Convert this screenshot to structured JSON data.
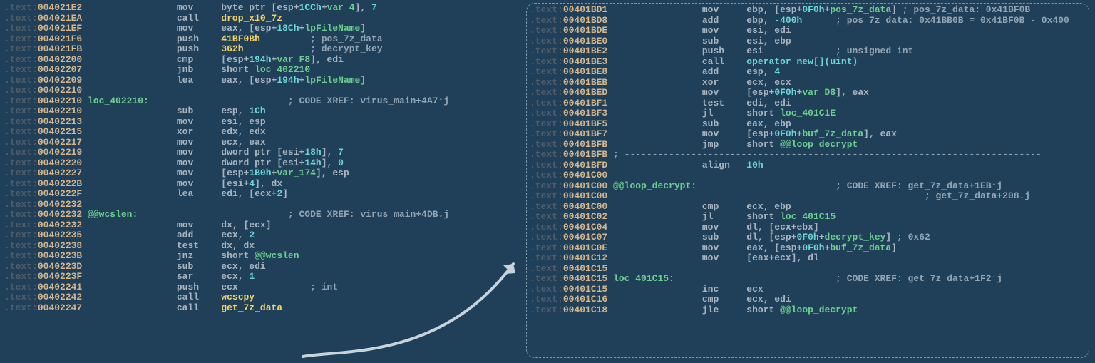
{
  "left": [
    {
      "addr": "004021E2",
      "m": "mov",
      "ops": [
        {
          "t": "plain",
          "v": "byte ptr "
        },
        {
          "t": "plain",
          "v": "["
        },
        {
          "t": "plain",
          "v": "esp"
        },
        {
          "t": "plain",
          "v": "+"
        },
        {
          "t": "num",
          "v": "1CCh"
        },
        {
          "t": "plain",
          "v": "+"
        },
        {
          "t": "var",
          "v": "var_4"
        },
        {
          "t": "plain",
          "v": "], "
        },
        {
          "t": "num",
          "v": "7"
        }
      ]
    },
    {
      "addr": "004021EA",
      "m": "call",
      "ops": [
        {
          "t": "func",
          "v": "drop_x10_7z"
        }
      ]
    },
    {
      "addr": "004021EF",
      "m": "mov",
      "ops": [
        {
          "t": "plain",
          "v": "eax, [esp+"
        },
        {
          "t": "num",
          "v": "18Ch"
        },
        {
          "t": "plain",
          "v": "+"
        },
        {
          "t": "var",
          "v": "lpFileName"
        },
        {
          "t": "plain",
          "v": "]"
        }
      ]
    },
    {
      "addr": "004021F6",
      "m": "push",
      "ops": [
        {
          "t": "func",
          "v": "41BF0Bh"
        },
        {
          "t": "plain",
          "v": "         "
        },
        {
          "t": "comment",
          "v": "; pos_7z_data"
        }
      ]
    },
    {
      "addr": "004021FB",
      "m": "push",
      "ops": [
        {
          "t": "func",
          "v": "362h"
        },
        {
          "t": "plain",
          "v": "            "
        },
        {
          "t": "comment",
          "v": "; decrypt_key"
        }
      ]
    },
    {
      "addr": "00402200",
      "m": "cmp",
      "ops": [
        {
          "t": "plain",
          "v": "[esp+"
        },
        {
          "t": "num",
          "v": "194h"
        },
        {
          "t": "plain",
          "v": "+"
        },
        {
          "t": "var",
          "v": "var_F8"
        },
        {
          "t": "plain",
          "v": "], edi"
        }
      ]
    },
    {
      "addr": "00402207",
      "m": "jnb",
      "ops": [
        {
          "t": "plain",
          "v": "short "
        },
        {
          "t": "var",
          "v": "loc_402210"
        }
      ]
    },
    {
      "addr": "00402209",
      "m": "lea",
      "ops": [
        {
          "t": "plain",
          "v": "eax, [esp+"
        },
        {
          "t": "num",
          "v": "194h"
        },
        {
          "t": "plain",
          "v": "+"
        },
        {
          "t": "var",
          "v": "lpFileName"
        },
        {
          "t": "plain",
          "v": "]"
        }
      ]
    },
    {
      "addr": "00402210",
      "m": "",
      "ops": []
    },
    {
      "addr": "00402210",
      "label": "loc_402210:",
      "m": "",
      "ops": [
        {
          "t": "plain",
          "v": "                         "
        },
        {
          "t": "comment",
          "v": "; CODE XREF: virus_main+4A7↑j"
        }
      ]
    },
    {
      "addr": "00402210",
      "m": "sub",
      "ops": [
        {
          "t": "plain",
          "v": "esp, "
        },
        {
          "t": "num",
          "v": "1Ch"
        }
      ]
    },
    {
      "addr": "00402213",
      "m": "mov",
      "ops": [
        {
          "t": "plain",
          "v": "esi, esp"
        }
      ]
    },
    {
      "addr": "00402215",
      "m": "xor",
      "ops": [
        {
          "t": "plain",
          "v": "edx, edx"
        }
      ]
    },
    {
      "addr": "00402217",
      "m": "mov",
      "ops": [
        {
          "t": "plain",
          "v": "ecx, eax"
        }
      ]
    },
    {
      "addr": "00402219",
      "m": "mov",
      "ops": [
        {
          "t": "plain",
          "v": "dword ptr [esi+"
        },
        {
          "t": "num",
          "v": "18h"
        },
        {
          "t": "plain",
          "v": "], "
        },
        {
          "t": "num",
          "v": "7"
        }
      ]
    },
    {
      "addr": "00402220",
      "m": "mov",
      "ops": [
        {
          "t": "plain",
          "v": "dword ptr [esi+"
        },
        {
          "t": "num",
          "v": "14h"
        },
        {
          "t": "plain",
          "v": "], "
        },
        {
          "t": "num",
          "v": "0"
        }
      ]
    },
    {
      "addr": "00402227",
      "m": "mov",
      "ops": [
        {
          "t": "plain",
          "v": "[esp+"
        },
        {
          "t": "num",
          "v": "1B0h"
        },
        {
          "t": "plain",
          "v": "+"
        },
        {
          "t": "var",
          "v": "var_174"
        },
        {
          "t": "plain",
          "v": "], esp"
        }
      ]
    },
    {
      "addr": "0040222B",
      "m": "mov",
      "ops": [
        {
          "t": "plain",
          "v": "[esi+"
        },
        {
          "t": "num",
          "v": "4"
        },
        {
          "t": "plain",
          "v": "], dx"
        }
      ]
    },
    {
      "addr": "0040222F",
      "m": "lea",
      "ops": [
        {
          "t": "plain",
          "v": "edi, [ecx+"
        },
        {
          "t": "num",
          "v": "2"
        },
        {
          "t": "plain",
          "v": "]"
        }
      ]
    },
    {
      "addr": "00402232",
      "m": "",
      "ops": []
    },
    {
      "addr": "00402232",
      "label": "@@wcslen:",
      "m": "",
      "ops": [
        {
          "t": "plain",
          "v": "                           "
        },
        {
          "t": "comment",
          "v": "; CODE XREF: virus_main+4DB↓j"
        }
      ]
    },
    {
      "addr": "00402232",
      "m": "mov",
      "ops": [
        {
          "t": "plain",
          "v": "dx, [ecx]"
        }
      ]
    },
    {
      "addr": "00402235",
      "m": "add",
      "ops": [
        {
          "t": "plain",
          "v": "ecx, "
        },
        {
          "t": "num",
          "v": "2"
        }
      ]
    },
    {
      "addr": "00402238",
      "m": "test",
      "ops": [
        {
          "t": "plain",
          "v": "dx, dx"
        }
      ]
    },
    {
      "addr": "0040223B",
      "m": "jnz",
      "ops": [
        {
          "t": "plain",
          "v": "short "
        },
        {
          "t": "var",
          "v": "@@wcslen"
        }
      ]
    },
    {
      "addr": "0040223D",
      "m": "sub",
      "ops": [
        {
          "t": "plain",
          "v": "ecx, edi"
        }
      ]
    },
    {
      "addr": "0040223F",
      "m": "sar",
      "ops": [
        {
          "t": "plain",
          "v": "ecx, "
        },
        {
          "t": "num",
          "v": "1"
        }
      ]
    },
    {
      "addr": "00402241",
      "m": "push",
      "ops": [
        {
          "t": "plain",
          "v": "ecx             "
        },
        {
          "t": "comment",
          "v": "; int"
        }
      ]
    },
    {
      "addr": "00402242",
      "m": "call",
      "ops": [
        {
          "t": "func",
          "v": "wcscpy"
        }
      ]
    },
    {
      "addr": "00402247",
      "m": "call",
      "ops": [
        {
          "t": "func",
          "v": "get_7z_data"
        }
      ]
    }
  ],
  "right": [
    {
      "addr": "00401BD1",
      "m": "mov",
      "ops": [
        {
          "t": "plain",
          "v": "ebp, [esp+"
        },
        {
          "t": "num",
          "v": "0F0h"
        },
        {
          "t": "plain",
          "v": "+"
        },
        {
          "t": "var",
          "v": "pos_7z_data"
        },
        {
          "t": "plain",
          "v": "] "
        },
        {
          "t": "comment",
          "v": "; pos_7z_data: 0x41BF0B"
        }
      ]
    },
    {
      "addr": "00401BD8",
      "m": "add",
      "ops": [
        {
          "t": "plain",
          "v": "ebp, "
        },
        {
          "t": "num",
          "v": "-400h"
        },
        {
          "t": "plain",
          "v": "      "
        },
        {
          "t": "comment",
          "v": "; pos_7z_data: 0x41BB0B = 0x41BF0B - 0x400"
        }
      ]
    },
    {
      "addr": "00401BDE",
      "m": "mov",
      "ops": [
        {
          "t": "plain",
          "v": "esi, edi"
        }
      ]
    },
    {
      "addr": "00401BE0",
      "m": "sub",
      "ops": [
        {
          "t": "plain",
          "v": "esi, ebp"
        }
      ]
    },
    {
      "addr": "00401BE2",
      "m": "push",
      "ops": [
        {
          "t": "plain",
          "v": "esi             "
        },
        {
          "t": "comment",
          "v": "; unsigned int"
        }
      ]
    },
    {
      "addr": "00401BE3",
      "m": "call",
      "ops": [
        {
          "t": "builtin",
          "v": "operator new[](uint)"
        }
      ]
    },
    {
      "addr": "00401BE8",
      "m": "add",
      "ops": [
        {
          "t": "plain",
          "v": "esp, "
        },
        {
          "t": "num",
          "v": "4"
        }
      ]
    },
    {
      "addr": "00401BEB",
      "m": "xor",
      "ops": [
        {
          "t": "plain",
          "v": "ecx, ecx"
        }
      ]
    },
    {
      "addr": "00401BED",
      "m": "mov",
      "ops": [
        {
          "t": "plain",
          "v": "[esp+"
        },
        {
          "t": "num",
          "v": "0F0h"
        },
        {
          "t": "plain",
          "v": "+"
        },
        {
          "t": "var",
          "v": "var_D8"
        },
        {
          "t": "plain",
          "v": "], eax"
        }
      ]
    },
    {
      "addr": "00401BF1",
      "m": "test",
      "ops": [
        {
          "t": "plain",
          "v": "edi, edi"
        }
      ]
    },
    {
      "addr": "00401BF3",
      "m": "jl",
      "ops": [
        {
          "t": "plain",
          "v": "short "
        },
        {
          "t": "var",
          "v": "loc_401C1E"
        }
      ]
    },
    {
      "addr": "00401BF5",
      "m": "sub",
      "ops": [
        {
          "t": "plain",
          "v": "eax, ebp"
        }
      ]
    },
    {
      "addr": "00401BF7",
      "m": "mov",
      "ops": [
        {
          "t": "plain",
          "v": "[esp+"
        },
        {
          "t": "num",
          "v": "0F0h"
        },
        {
          "t": "plain",
          "v": "+"
        },
        {
          "t": "var",
          "v": "buf_7z_data"
        },
        {
          "t": "plain",
          "v": "], eax"
        }
      ]
    },
    {
      "addr": "00401BFB",
      "m": "jmp",
      "ops": [
        {
          "t": "plain",
          "v": "short "
        },
        {
          "t": "var",
          "v": "@@loop_decrypt"
        }
      ]
    },
    {
      "addr": "00401BFB",
      "sep": true,
      "m": "",
      "ops": [
        {
          "t": "comment",
          "v": "; ---------------------------------------------------------------------------"
        }
      ]
    },
    {
      "addr": "00401BFD",
      "m": "align",
      "ops": [
        {
          "t": "num",
          "v": "10h"
        }
      ]
    },
    {
      "addr": "00401C00",
      "m": "",
      "ops": []
    },
    {
      "addr": "00401C00",
      "label": "@@loop_decrypt:",
      "m": "",
      "ops": [
        {
          "t": "plain",
          "v": "                         "
        },
        {
          "t": "comment",
          "v": "; CODE XREF: get_7z_data+1EB↑j"
        }
      ]
    },
    {
      "addr": "00401C00",
      "m": "",
      "ops": [
        {
          "t": "plain",
          "v": "                                        "
        },
        {
          "t": "comment",
          "v": "; get_7z_data+208↓j"
        }
      ]
    },
    {
      "addr": "00401C00",
      "m": "cmp",
      "ops": [
        {
          "t": "plain",
          "v": "ecx, ebp"
        }
      ]
    },
    {
      "addr": "00401C02",
      "m": "jl",
      "ops": [
        {
          "t": "plain",
          "v": "short "
        },
        {
          "t": "var",
          "v": "loc_401C15"
        }
      ]
    },
    {
      "addr": "00401C04",
      "m": "mov",
      "ops": [
        {
          "t": "plain",
          "v": "dl, [ecx+ebx]"
        }
      ]
    },
    {
      "addr": "00401C07",
      "m": "sub",
      "ops": [
        {
          "t": "plain",
          "v": "dl, [esp+"
        },
        {
          "t": "num",
          "v": "0F0h"
        },
        {
          "t": "plain",
          "v": "+"
        },
        {
          "t": "var",
          "v": "decrypt_key"
        },
        {
          "t": "plain",
          "v": "] "
        },
        {
          "t": "comment",
          "v": "; 0x62"
        }
      ]
    },
    {
      "addr": "00401C0E",
      "m": "mov",
      "ops": [
        {
          "t": "plain",
          "v": "eax, [esp+"
        },
        {
          "t": "num",
          "v": "0F0h"
        },
        {
          "t": "plain",
          "v": "+"
        },
        {
          "t": "var",
          "v": "buf_7z_data"
        },
        {
          "t": "plain",
          "v": "]"
        }
      ]
    },
    {
      "addr": "00401C12",
      "m": "mov",
      "ops": [
        {
          "t": "plain",
          "v": "[eax+ecx], dl"
        }
      ]
    },
    {
      "addr": "00401C15",
      "m": "",
      "ops": []
    },
    {
      "addr": "00401C15",
      "label": "loc_401C15:",
      "m": "",
      "ops": [
        {
          "t": "plain",
          "v": "                             "
        },
        {
          "t": "comment",
          "v": "; CODE XREF: get_7z_data+1F2↑j"
        }
      ]
    },
    {
      "addr": "00401C15",
      "m": "inc",
      "ops": [
        {
          "t": "plain",
          "v": "ecx"
        }
      ]
    },
    {
      "addr": "00401C16",
      "m": "cmp",
      "ops": [
        {
          "t": "plain",
          "v": "ecx, edi"
        }
      ]
    },
    {
      "addr": "00401C18",
      "m": "jle",
      "ops": [
        {
          "t": "plain",
          "v": "short "
        },
        {
          "t": "var",
          "v": "@@loop_decrypt"
        }
      ]
    }
  ]
}
